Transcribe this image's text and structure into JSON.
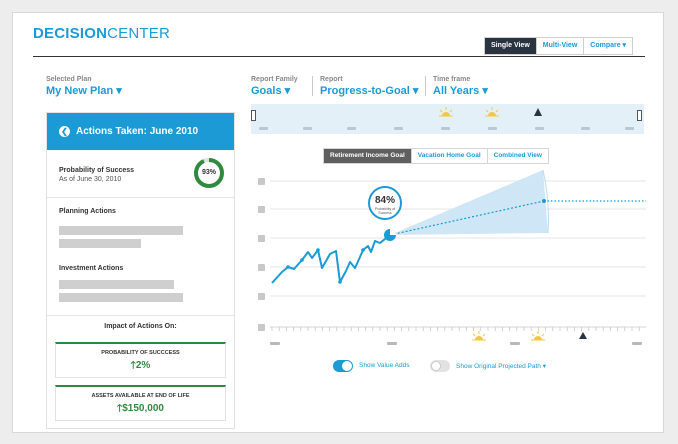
{
  "brand": {
    "bold": "DECISION",
    "light": "CENTER"
  },
  "view_tabs": [
    "Single View",
    "Multi-View",
    "Compare ▾"
  ],
  "selectors": {
    "plan": {
      "label": "Selected Plan",
      "value": "My New Plan ▾"
    },
    "family": {
      "label": "Report Family",
      "value": "Goals ▾"
    },
    "report": {
      "label": "Report",
      "value": "Progress-to-Goal ▾"
    },
    "timeframe": {
      "label": "Time frame",
      "value": "All Years ▾"
    }
  },
  "left": {
    "header": "Actions Taken: June 2010",
    "probability_title": "Probability of Success",
    "probability_date": "As of June 30, 2010",
    "probability_value": "93%",
    "probability_fraction": 0.93,
    "planning_title": "Planning Actions",
    "investment_title": "Investment Actions",
    "impact_title": "Impact of Actions On:",
    "impact_items": [
      {
        "label": "PROBABILITY OF SUCCCESS",
        "value": "2%"
      },
      {
        "label": "ASSETS AVAILABLE AT END OF LIFE",
        "value": "$150,000"
      }
    ]
  },
  "goal_tabs": [
    "Retirement Income Goal",
    "Vacation Home Goal",
    "Combined View"
  ],
  "chart_bubble": {
    "value": "84%",
    "caption_1": "Probability of",
    "caption_2": "Success"
  },
  "toggles": [
    {
      "label": "Show Value Adds",
      "on": true
    },
    {
      "label": "Show Original Projected Path ▾",
      "on": false
    }
  ],
  "colors": {
    "accent": "#1b9ad6",
    "positive": "#2e8b3e",
    "dark": "#2a3340",
    "sun": "#f3c742"
  }
}
